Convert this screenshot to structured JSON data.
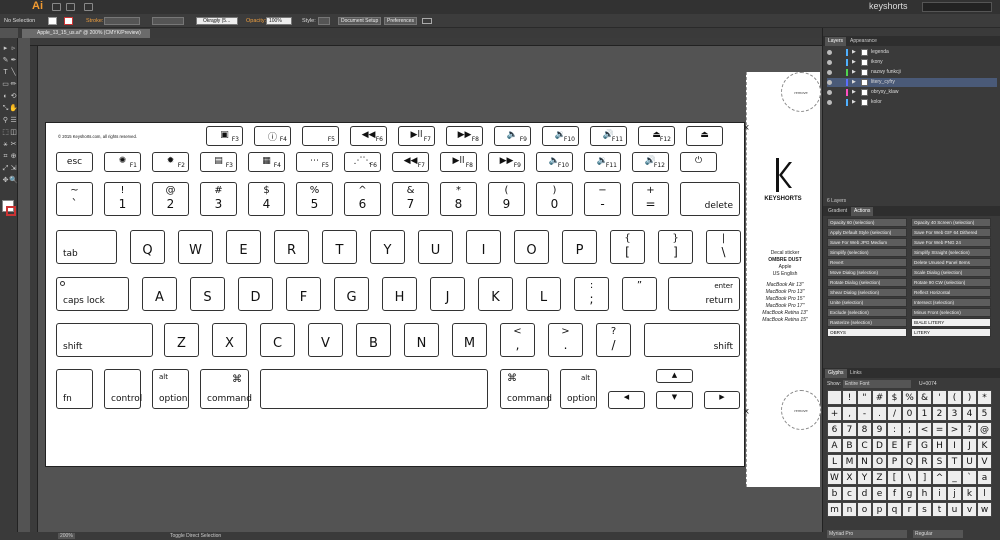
{
  "app": {
    "logo": "Ai",
    "workspace": "keyshorts"
  },
  "control_bar": {
    "selection": "No Selection",
    "stroke_label": "Stroke:",
    "brush": "Okrągły (5...",
    "opacity_label": "Opacity:",
    "opacity_value": "100%",
    "style_label": "Style:",
    "doc_setup": "Document Setup",
    "preferences": "Preferences"
  },
  "document": {
    "tab": "Apple_13_15_us.ai* @ 200% (CMYK/Preview)"
  },
  "status": {
    "zoom": "200%",
    "tool": "Toggle Direct Selection"
  },
  "artboard": {
    "copyright": "© 2015 Keyshorts.com, all rights reserved.",
    "rows": [
      [
        [
          "F3",
          "▣"
        ],
        [
          "F4",
          "ⓘ"
        ],
        [
          "F5",
          ""
        ],
        [
          "F6",
          "◀◀"
        ],
        [
          "F7",
          "▶ll"
        ],
        [
          "F8",
          "▶▶"
        ],
        [
          "F9",
          "🔈"
        ],
        [
          "F10",
          "🔉"
        ],
        [
          "F11",
          "🔊"
        ],
        [
          "F12",
          "⏏"
        ],
        [
          "",
          "⏏"
        ]
      ],
      [
        [
          "esc",
          ""
        ],
        [
          "F1",
          "✺"
        ],
        [
          "F2",
          "✹"
        ],
        [
          "F3",
          "▤"
        ],
        [
          "F4",
          "▦"
        ],
        [
          "F5",
          "⋯"
        ],
        [
          "F6",
          "⋰⋱"
        ],
        [
          "F7",
          "◀◀"
        ],
        [
          "F8",
          "▶ll"
        ],
        [
          "F9",
          "▶▶"
        ],
        [
          "F10",
          "🔈"
        ],
        [
          "F11",
          "🔉"
        ],
        [
          "F12",
          "🔊"
        ],
        [
          "",
          "⏻"
        ]
      ]
    ],
    "num_row": [
      [
        "~",
        "`"
      ],
      [
        "!",
        "1"
      ],
      [
        "@",
        "2"
      ],
      [
        "#",
        "3"
      ],
      [
        "$",
        "4"
      ],
      [
        "%",
        "5"
      ],
      [
        "^",
        "6"
      ],
      [
        "&",
        "7"
      ],
      [
        "*",
        "8"
      ],
      [
        "(",
        "9"
      ],
      [
        ")",
        "0"
      ],
      [
        "−",
        "-"
      ],
      [
        "+",
        "="
      ]
    ],
    "delete": "delete",
    "tab": "tab",
    "qrow": [
      "Q",
      "W",
      "E",
      "R",
      "T",
      "Y",
      "U",
      "I",
      "O",
      "P"
    ],
    "qrow_sym": [
      [
        "{",
        "["
      ],
      [
        "}",
        "]"
      ],
      [
        "|",
        "\\"
      ]
    ],
    "caps": "caps lock",
    "arow": [
      "A",
      "S",
      "D",
      "F",
      "G",
      "H",
      "J",
      "K",
      "L"
    ],
    "arow_sym": [
      [
        ":",
        ";"
      ],
      [
        "”",
        ""
      ]
    ],
    "enter": "enter",
    "return": "return",
    "shift": "shift",
    "zrow": [
      "Z",
      "X",
      "C",
      "V",
      "B",
      "N",
      "M"
    ],
    "zrow_sym": [
      [
        "<",
        ","
      ],
      [
        ">",
        "."
      ],
      [
        "?",
        "/"
      ]
    ],
    "fn": "fn",
    "control": "control",
    "alt": "alt",
    "option": "option",
    "cmd_sym": "⌘",
    "command": "command",
    "arrows": [
      "▲",
      "◀",
      "▼",
      "▶"
    ]
  },
  "sticker": {
    "remove": "remove",
    "logo": "KEYSHORTS",
    "info": [
      "Decal sticker",
      "OMBRE DUST",
      "Apple",
      "US English",
      "",
      "MacBook Air 13\"",
      "MacBook Pro 13\"",
      "MacBook Pro 15\"",
      "MacBook Pro 17\"",
      "MacBook Retina 13\"",
      "MacBook Retina 15\""
    ]
  },
  "layers_panel": {
    "tabs": [
      "Layers",
      "Appearance"
    ],
    "layers": [
      {
        "name": "legenda",
        "color": "#4fb0ff"
      },
      {
        "name": "ikony",
        "color": "#4fb0ff"
      },
      {
        "name": "nazwy funkcji",
        "color": "#4fd44f"
      },
      {
        "name": "litery_cyfry",
        "color": "#5a6eff"
      },
      {
        "name": "obrysy_klaw",
        "color": "#ff4fc0"
      },
      {
        "name": "kolor",
        "color": "#4fb0ff"
      }
    ],
    "count": "6 Layers"
  },
  "actions_panel": {
    "tabs": [
      "Gradient",
      "Actions"
    ],
    "left": [
      "Opacity 60 (selection)",
      "Apply Default Style (selection)",
      "Save For Web JPG Medium",
      "Simplify (selection)",
      "Revert",
      "Move Dialog (selection)",
      "Rotate Dialog (selection)",
      "Shear Dialog (selection)",
      "Unite (selection)",
      "Exclude (selection)",
      "Rasterize (selection)",
      "OBRYS"
    ],
    "right": [
      "Opacity 40 Screen (selection)",
      "Save For Web GIF 64 Dithered",
      "Save For Web PNG 24",
      "Simplify Straight (selection)",
      "Delete Unused Panel Items",
      "Scale Dialog (selection)",
      "Rotate 90 CW (selection)",
      "Reflect Horizontal",
      "Intersect (selection)",
      "Minus Front (selection)",
      "BIALE LITERY",
      "LITERY"
    ]
  },
  "glyphs_panel": {
    "tabs": [
      "Glyphs",
      "Links"
    ],
    "show_label": "Show:",
    "show_value": "Entire Font",
    "unicode": "U+0074",
    "font": "Myriad Pro",
    "weight": "Regular",
    "glyphs": [
      "",
      "!",
      "\"",
      "#",
      "$",
      "%",
      "&",
      "'",
      "(",
      ")",
      "*",
      "+",
      ",",
      "-",
      ".",
      "/",
      "0",
      "1",
      "2",
      "3",
      "4",
      "5",
      "6",
      "7",
      "8",
      "9",
      ":",
      ";",
      "<",
      "=",
      ">",
      "?",
      "@",
      "A",
      "B",
      "C",
      "D",
      "E",
      "F",
      "G",
      "H",
      "I",
      "J",
      "K",
      "L",
      "M",
      "N",
      "O",
      "P",
      "Q",
      "R",
      "S",
      "T",
      "U",
      "V",
      "W",
      "X",
      "Y",
      "Z",
      "[",
      "\\",
      "]",
      "^",
      "_",
      "`",
      "a",
      "b",
      "c",
      "d",
      "e",
      "f",
      "g",
      "h",
      "i",
      "j",
      "k",
      "l",
      "m",
      "n",
      "o",
      "p",
      "q",
      "r",
      "s",
      "t",
      "u",
      "v",
      "w",
      "x",
      "y",
      "z",
      "{",
      "|",
      "}",
      "~",
      "¡",
      "¢",
      "£",
      "¤",
      "¥",
      "¦",
      "§",
      "¨",
      "©",
      "ª",
      "«",
      "¬",
      "®",
      "¯",
      "°",
      "±",
      "²",
      "³",
      "´",
      "µ",
      "¶",
      "·",
      "¸",
      "¹",
      "º",
      "»",
      "¼",
      "½",
      "¾",
      "¿"
    ]
  }
}
